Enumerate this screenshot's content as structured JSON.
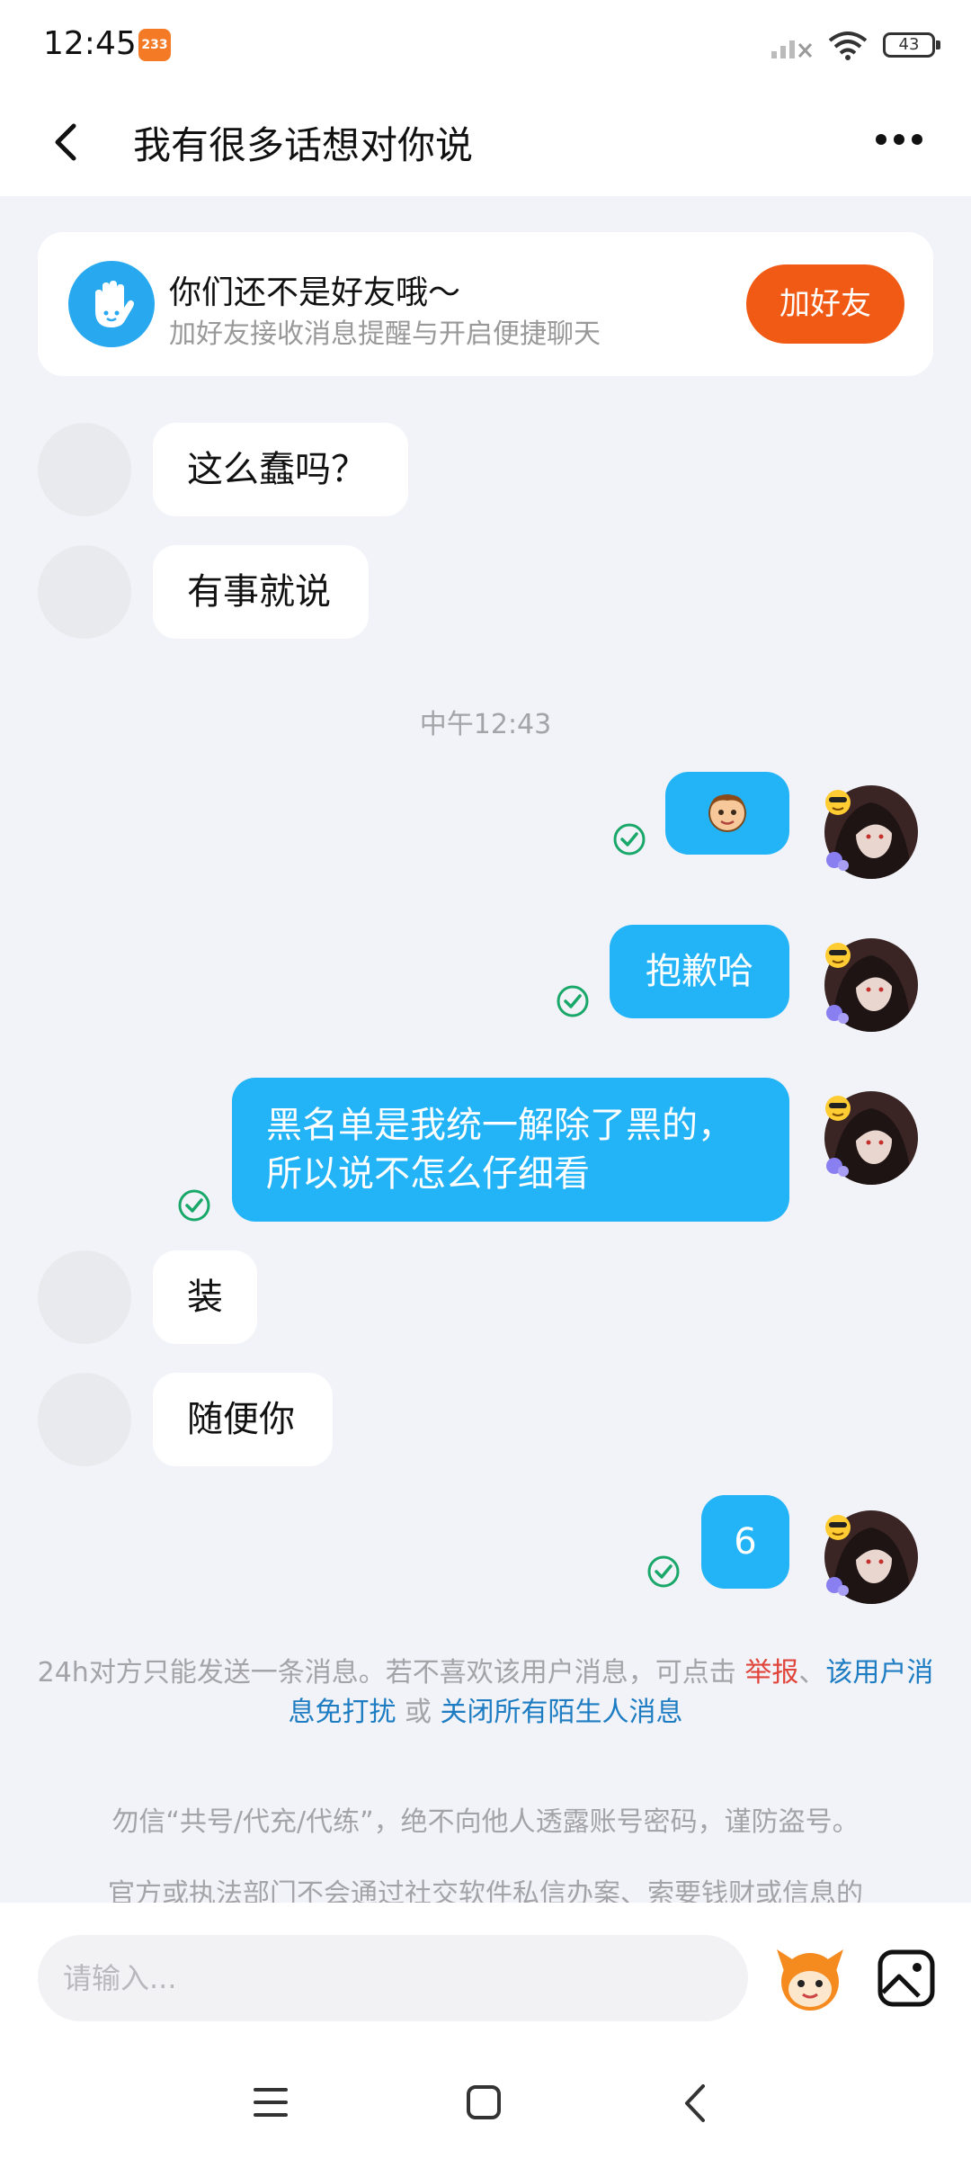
{
  "status_bar": {
    "time": "12:45",
    "notif_badge": "233",
    "battery": "43"
  },
  "header": {
    "title": "我有很多话想对你说"
  },
  "friend_card": {
    "title": "你们还不是好友哦～",
    "subtitle": "加好友接收消息提醒与开启便捷聊天",
    "add_button": "加好友"
  },
  "messages": [
    {
      "from": "them",
      "text": "这么蠢吗？"
    },
    {
      "from": "them",
      "text": "有事就说"
    },
    {
      "from": "time",
      "text": "中午12:43"
    },
    {
      "from": "me",
      "text": "",
      "type": "sticker",
      "status": "sent"
    },
    {
      "from": "me",
      "text": "抱歉哈",
      "status": "sent"
    },
    {
      "from": "me",
      "line1": "黑名单是我统一解除了黑的，",
      "line2": "所以说不怎么仔细看",
      "status": "sent"
    },
    {
      "from": "them",
      "text": "装"
    },
    {
      "from": "them",
      "text": "随便你"
    },
    {
      "from": "me",
      "text": "6",
      "status": "sent"
    }
  ],
  "notice": {
    "prefix": "24h对方只能发送一条消息。若不喜欢该用户消息，可点击 ",
    "report": "举报",
    "sep": "、",
    "mute": "该用户消息免打扰",
    "or": " 或 ",
    "close_all": "关闭所有陌生人消息"
  },
  "warnings": {
    "line1": "勿信“共号/代充/代练”，绝不向他人透露账号密码，谨防盗号。",
    "line2": "官方或执法部门不会通过社交软件私信办案、索要钱财或信息的"
  },
  "input": {
    "placeholder": "请输入..."
  },
  "colors": {
    "accent_blue": "#23b4f8",
    "add_button": "#f05a14",
    "check_green": "#1aa86a"
  }
}
